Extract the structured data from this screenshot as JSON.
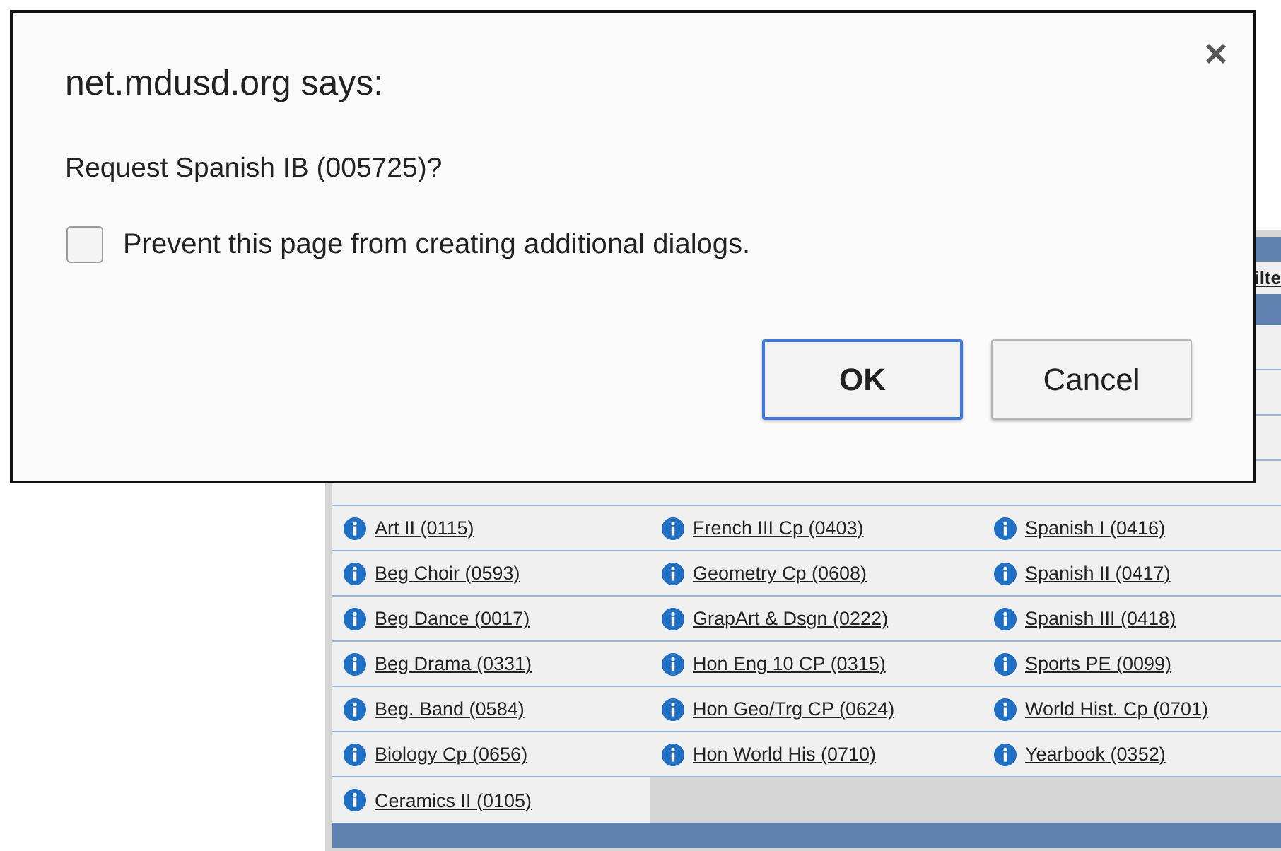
{
  "dialog": {
    "title": "net.mdusd.org says:",
    "message": "Request Spanish IB (005725)?",
    "checkbox": {
      "label": "Prevent this page from creating additional dialogs.",
      "checked": false
    },
    "buttons": [
      {
        "label": "OK",
        "focused": true
      },
      {
        "label": "Cancel",
        "focused": false
      }
    ]
  },
  "page": {
    "header_link": "ilte",
    "course_rows": [
      [
        "Art II (0115)",
        "French III Cp (0403)",
        "Spanish I (0416)"
      ],
      [
        "Beg Choir (0593)",
        "Geometry Cp (0608)",
        "Spanish II (0417)"
      ],
      [
        "Beg Dance (0017)",
        "GrapArt & Dsgn (0222)",
        "Spanish III (0418)"
      ],
      [
        "Beg Drama (0331)",
        "Hon Eng 10 CP (0315)",
        "Sports PE (0099)"
      ],
      [
        "Beg. Band (0584)",
        "Hon Geo/Trg CP (0624)",
        "World Hist. Cp (0701)"
      ],
      [
        "Biology Cp (0656)",
        "Hon World His (0710)",
        "Yearbook (0352)"
      ],
      [
        "Ceramics II (0105)"
      ]
    ]
  }
}
